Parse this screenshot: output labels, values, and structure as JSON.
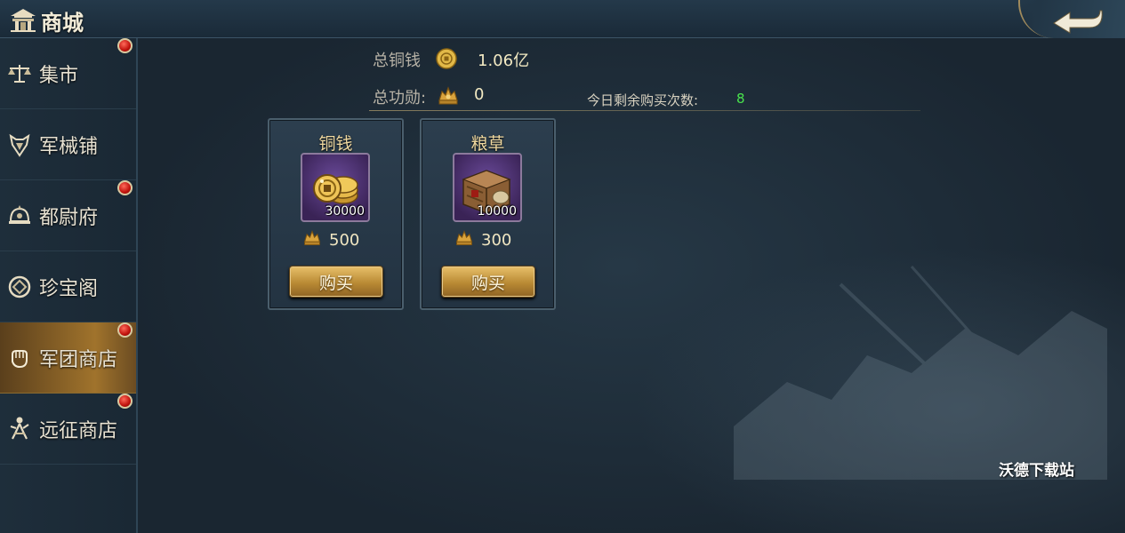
{
  "header": {
    "title": "商城"
  },
  "sidebar": {
    "items": [
      {
        "label": "集市",
        "icon": "scale-icon",
        "badge": true,
        "active": false
      },
      {
        "label": "军械铺",
        "icon": "armor-icon",
        "badge": false,
        "active": false
      },
      {
        "label": "都尉府",
        "icon": "helmet-icon",
        "badge": true,
        "active": false
      },
      {
        "label": "珍宝阁",
        "icon": "treasure-coin-icon",
        "badge": false,
        "active": false
      },
      {
        "label": "军团商店",
        "icon": "legion-hand-icon",
        "badge": true,
        "active": true
      },
      {
        "label": "远征商店",
        "icon": "expedition-figure-icon",
        "badge": true,
        "active": false
      }
    ]
  },
  "stats": {
    "copper_label": "总铜钱",
    "copper_value": "1.06亿",
    "merit_label": "总功勋:",
    "merit_value": "0",
    "remaining_label": "今日剩余购买次数:",
    "remaining_value": "8"
  },
  "shop": {
    "items": [
      {
        "name": "铜钱",
        "quantity": "30000",
        "price": "500",
        "buy_label": "购买",
        "icon": "copper-coins-icon"
      },
      {
        "name": "粮草",
        "quantity": "10000",
        "price": "300",
        "buy_label": "购买",
        "icon": "supply-crate-icon"
      }
    ]
  },
  "watermark": "沃德下载站",
  "colors": {
    "accent_gold": "#c89a45",
    "remaining_green": "#49e44d",
    "badge_red": "#c0120c",
    "item_frame_purple": "#4a2f72"
  }
}
